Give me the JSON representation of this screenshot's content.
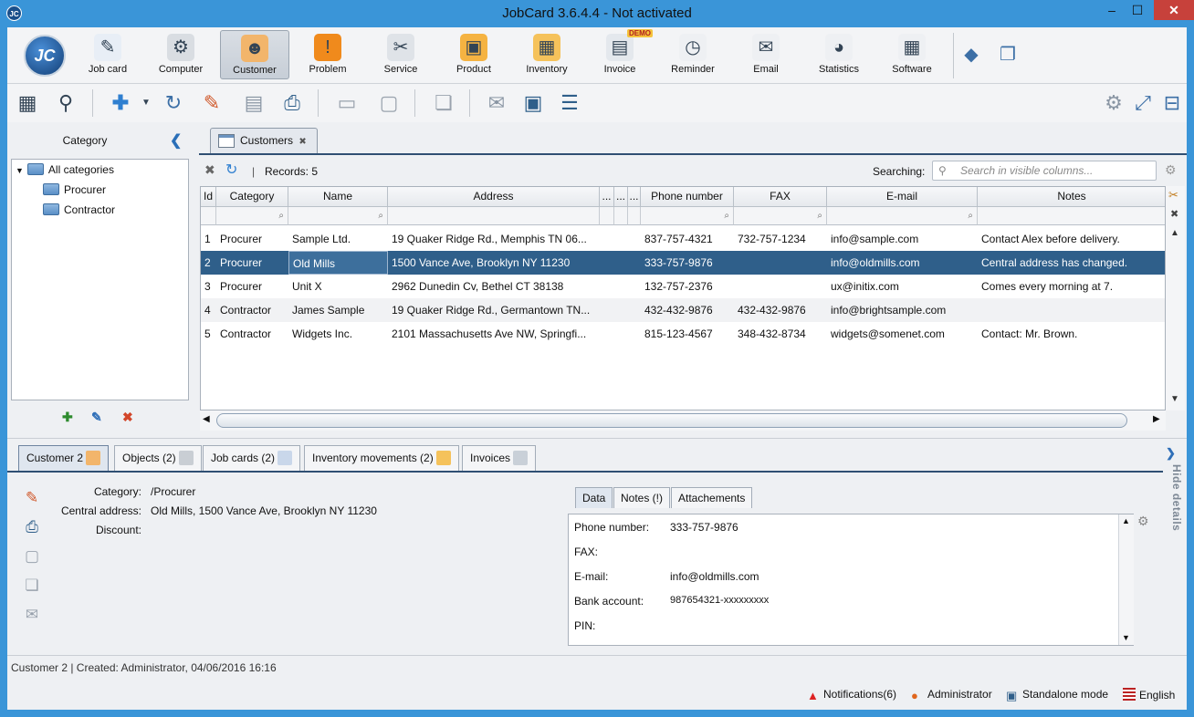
{
  "window": {
    "title": "JobCard 3.6.4.4 - Not activated",
    "app_icon": "JC",
    "controls": [
      "–",
      "☐",
      "✕"
    ]
  },
  "modules": [
    {
      "label": "Job card",
      "icon": "jobcard-icon",
      "glyph": "✎",
      "color": "#e8eef6"
    },
    {
      "label": "Computer",
      "icon": "gear-icon",
      "glyph": "⚙",
      "color": "#d9dde2"
    },
    {
      "label": "Customer",
      "icon": "customer-icon",
      "glyph": "☻",
      "color": "#f2b56b",
      "selected": true
    },
    {
      "label": "Problem",
      "icon": "problem-icon",
      "glyph": "!",
      "color": "#f08a1c"
    },
    {
      "label": "Service",
      "icon": "tools-icon",
      "glyph": "✂",
      "color": "#dfe3e8"
    },
    {
      "label": "Product",
      "icon": "box-icon",
      "glyph": "▣",
      "color": "#f5b342"
    },
    {
      "label": "Inventory",
      "icon": "boxes-icon",
      "glyph": "▦",
      "color": "#f5c25b"
    },
    {
      "label": "Invoice",
      "icon": "invoice-icon",
      "glyph": "▤",
      "color": "#e4e8ed",
      "badge": "DEMO"
    },
    {
      "label": "Reminder",
      "icon": "clock-icon",
      "glyph": "◷",
      "color": "#eef0f3"
    },
    {
      "label": "Email",
      "icon": "envelope-icon",
      "glyph": "✉",
      "color": "#eef0f3"
    },
    {
      "label": "Statistics",
      "icon": "pie-chart-icon",
      "glyph": "◕",
      "color": "#eef0f3"
    },
    {
      "label": "Software",
      "icon": "software-icon",
      "glyph": "▦",
      "color": "#eef0f3"
    }
  ],
  "category_panel": {
    "title": "Category",
    "tree": [
      {
        "label": "All categories",
        "level": 0
      },
      {
        "label": "Procurer",
        "level": 1
      },
      {
        "label": "Contractor",
        "level": 1
      }
    ]
  },
  "customers_tab": {
    "label": "Customers",
    "close": "✖"
  },
  "grid_toolbar": {
    "records": "Records: 5",
    "searching_label": "Searching:",
    "search_placeholder": "Search in visible columns..."
  },
  "columns": [
    "Id",
    "Category",
    "Name",
    "Address",
    "...",
    "...",
    "...",
    "Phone number",
    "FAX",
    "E-mail",
    "Notes"
  ],
  "rows": [
    {
      "id": "1",
      "category": "Procurer",
      "name": "Sample Ltd.",
      "address": "19 Quaker Ridge Rd., Memphis TN 06...",
      "phone": "837-757-4321",
      "fax": "732-757-1234",
      "email": "info@sample.com",
      "notes": "Contact Alex before delivery."
    },
    {
      "id": "2",
      "category": "Procurer",
      "name": "Old Mills",
      "address": "1500 Vance Ave, Brooklyn NY 11230",
      "phone": "333-757-9876",
      "fax": "",
      "email": "info@oldmills.com",
      "notes": "Central address has changed."
    },
    {
      "id": "3",
      "category": "Procurer",
      "name": "Unit X",
      "address": "2962 Dunedin Cv, Bethel CT 38138",
      "phone": "132-757-2376",
      "fax": "",
      "email": "ux@initix.com",
      "notes": "Comes every morning at 7."
    },
    {
      "id": "4",
      "category": "Contractor",
      "name": "James Sample",
      "address": "19 Quaker Ridge Rd., Germantown TN...",
      "phone": "432-432-9876",
      "fax": "432-432-9876",
      "email": "info@brightsample.com",
      "notes": ""
    },
    {
      "id": "5",
      "category": "Contractor",
      "name": "Widgets Inc.",
      "address": "2101 Massachusetts Ave NW, Springfi...",
      "phone": "815-123-4567",
      "fax": "348-432-8734",
      "email": "widgets@somenet.com",
      "notes": "Contact: Mr. Brown."
    }
  ],
  "detail_tabs": [
    "Customer 2",
    "Objects (2)",
    "Job cards (2)",
    "Inventory movements (2)",
    "Invoices"
  ],
  "detail": {
    "category_label": "Category:",
    "category_value": "/Procurer",
    "address_label": "Central address:",
    "address_value": "Old Mills, 1500 Vance Ave, Brooklyn NY 11230",
    "discount_label": "Discount:"
  },
  "inner_tabs": [
    "Data",
    "Notes (!)",
    "Attachements"
  ],
  "data_fields": [
    {
      "label": "Phone number:",
      "value": "333-757-9876"
    },
    {
      "label": "FAX:",
      "value": ""
    },
    {
      "label": "E-mail:",
      "value": "info@oldmills.com"
    },
    {
      "label": "Bank account:",
      "value": "987654321-xxxxxxxxx"
    },
    {
      "label": "PIN:",
      "value": ""
    }
  ],
  "hide_details": "Hide details",
  "status": {
    "text": "Customer 2 | Created: Administrator, 04/06/2016 16:16",
    "notifications": "Notifications(6)",
    "user": "Administrator",
    "mode": "Standalone mode",
    "language": "English"
  }
}
